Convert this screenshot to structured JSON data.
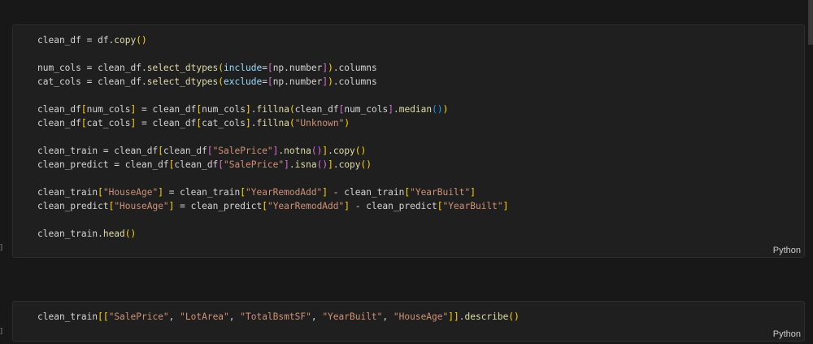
{
  "cells": [
    {
      "language": "Python",
      "exec_marker": "]",
      "lines": [
        [
          [
            "clean_df = df.",
            "v"
          ],
          [
            "copy",
            "fn"
          ],
          [
            "()",
            "b1"
          ]
        ],
        [],
        [
          [
            "num_cols = clean_df.",
            "v"
          ],
          [
            "select_dtypes",
            "fn"
          ],
          [
            "(",
            "b1"
          ],
          [
            "include",
            "pm"
          ],
          [
            "=",
            "v"
          ],
          [
            "[",
            "b2"
          ],
          [
            "np.number",
            "v"
          ],
          [
            "]",
            "b2"
          ],
          [
            ")",
            "b1"
          ],
          [
            ".columns",
            "v"
          ]
        ],
        [
          [
            "cat_cols = clean_df.",
            "v"
          ],
          [
            "select_dtypes",
            "fn"
          ],
          [
            "(",
            "b1"
          ],
          [
            "exclude",
            "pm"
          ],
          [
            "=",
            "v"
          ],
          [
            "[",
            "b2"
          ],
          [
            "np.number",
            "v"
          ],
          [
            "]",
            "b2"
          ],
          [
            ")",
            "b1"
          ],
          [
            ".columns",
            "v"
          ]
        ],
        [],
        [
          [
            "clean_df",
            "v"
          ],
          [
            "[",
            "b1"
          ],
          [
            "num_cols",
            "v"
          ],
          [
            "]",
            "b1"
          ],
          [
            " = clean_df",
            "v"
          ],
          [
            "[",
            "b1"
          ],
          [
            "num_cols",
            "v"
          ],
          [
            "]",
            "b1"
          ],
          [
            ".",
            "v"
          ],
          [
            "fillna",
            "fn"
          ],
          [
            "(",
            "b1"
          ],
          [
            "clean_df",
            "v"
          ],
          [
            "[",
            "b2"
          ],
          [
            "num_cols",
            "v"
          ],
          [
            "]",
            "b2"
          ],
          [
            ".",
            "v"
          ],
          [
            "median",
            "fn"
          ],
          [
            "()",
            "b3"
          ],
          [
            ")",
            "b1"
          ]
        ],
        [
          [
            "clean_df",
            "v"
          ],
          [
            "[",
            "b1"
          ],
          [
            "cat_cols",
            "v"
          ],
          [
            "]",
            "b1"
          ],
          [
            " = clean_df",
            "v"
          ],
          [
            "[",
            "b1"
          ],
          [
            "cat_cols",
            "v"
          ],
          [
            "]",
            "b1"
          ],
          [
            ".",
            "v"
          ],
          [
            "fillna",
            "fn"
          ],
          [
            "(",
            "b1"
          ],
          [
            "\"Unknown\"",
            "s"
          ],
          [
            ")",
            "b1"
          ]
        ],
        [],
        [
          [
            "clean_train = clean_df",
            "v"
          ],
          [
            "[",
            "b1"
          ],
          [
            "clean_df",
            "v"
          ],
          [
            "[",
            "b2"
          ],
          [
            "\"SalePrice\"",
            "s"
          ],
          [
            "]",
            "b2"
          ],
          [
            ".",
            "v"
          ],
          [
            "notna",
            "fn"
          ],
          [
            "()",
            "b2"
          ],
          [
            "]",
            "b1"
          ],
          [
            ".",
            "v"
          ],
          [
            "copy",
            "fn"
          ],
          [
            "()",
            "b1"
          ]
        ],
        [
          [
            "clean_predict = clean_df",
            "v"
          ],
          [
            "[",
            "b1"
          ],
          [
            "clean_df",
            "v"
          ],
          [
            "[",
            "b2"
          ],
          [
            "\"SalePrice\"",
            "s"
          ],
          [
            "]",
            "b2"
          ],
          [
            ".",
            "v"
          ],
          [
            "isna",
            "fn"
          ],
          [
            "()",
            "b2"
          ],
          [
            "]",
            "b1"
          ],
          [
            ".",
            "v"
          ],
          [
            "copy",
            "fn"
          ],
          [
            "()",
            "b1"
          ]
        ],
        [],
        [
          [
            "clean_train",
            "v"
          ],
          [
            "[",
            "b1"
          ],
          [
            "\"HouseAge\"",
            "s"
          ],
          [
            "]",
            "b1"
          ],
          [
            " = clean_train",
            "v"
          ],
          [
            "[",
            "b1"
          ],
          [
            "\"YearRemodAdd\"",
            "s"
          ],
          [
            "]",
            "b1"
          ],
          [
            " - clean_train",
            "v"
          ],
          [
            "[",
            "b1"
          ],
          [
            "\"YearBuilt\"",
            "s"
          ],
          [
            "]",
            "b1"
          ]
        ],
        [
          [
            "clean_predict",
            "v"
          ],
          [
            "[",
            "b1"
          ],
          [
            "\"HouseAge\"",
            "s"
          ],
          [
            "]",
            "b1"
          ],
          [
            " = clean_predict",
            "v"
          ],
          [
            "[",
            "b1"
          ],
          [
            "\"YearRemodAdd\"",
            "s"
          ],
          [
            "]",
            "b1"
          ],
          [
            " - clean_predict",
            "v"
          ],
          [
            "[",
            "b1"
          ],
          [
            "\"YearBuilt\"",
            "s"
          ],
          [
            "]",
            "b1"
          ]
        ],
        [],
        [
          [
            "clean_train.",
            "v"
          ],
          [
            "head",
            "fn"
          ],
          [
            "()",
            "b1"
          ]
        ]
      ]
    },
    {
      "language": "Python",
      "exec_marker": "]",
      "lines": [
        [
          [
            "clean_train",
            "v"
          ],
          [
            "[[",
            "b1"
          ],
          [
            "\"SalePrice\"",
            "s"
          ],
          [
            ", ",
            "v"
          ],
          [
            "\"LotArea\"",
            "s"
          ],
          [
            ", ",
            "v"
          ],
          [
            "\"TotalBsmtSF\"",
            "s"
          ],
          [
            ", ",
            "v"
          ],
          [
            "\"YearBuilt\"",
            "s"
          ],
          [
            ", ",
            "v"
          ],
          [
            "\"HouseAge\"",
            "s"
          ],
          [
            "]]",
            "b1"
          ],
          [
            ".",
            "v"
          ],
          [
            "describe",
            "fn"
          ],
          [
            "()",
            "b1"
          ]
        ]
      ]
    }
  ],
  "colors": {
    "background": "#181818",
    "cell_background": "#1f1f1f",
    "text": "#d4d4d4",
    "function": "#dcdcaa",
    "string": "#ce9178",
    "parameter": "#9cdcfe",
    "bracket_level1": "#ffd700",
    "bracket_level2": "#da70d6",
    "bracket_level3": "#179fff"
  }
}
